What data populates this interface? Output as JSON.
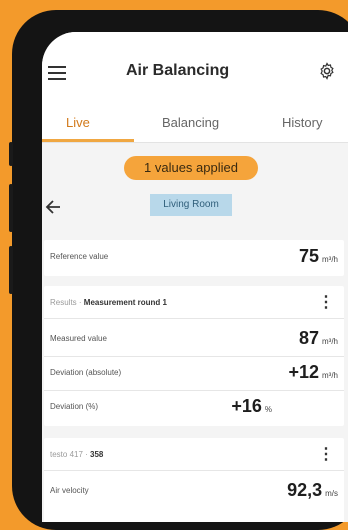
{
  "header": {
    "title": "Air Balancing"
  },
  "tabs": [
    {
      "label": "Live",
      "active": true
    },
    {
      "label": "Balancing",
      "active": false
    },
    {
      "label": "History",
      "active": false
    }
  ],
  "status_pill": "1 values applied",
  "room": "Living Room",
  "reference": {
    "label": "Reference value",
    "value": "75",
    "unit": "m³/h"
  },
  "round": {
    "prefix": "Results · ",
    "title": "Measurement round 1",
    "rows": [
      {
        "label": "Measured value",
        "value": "87",
        "unit": "m³/h"
      },
      {
        "label": "Deviation (absolute)",
        "value": "+12",
        "unit": "m³/h"
      },
      {
        "label": "Deviation (%)",
        "value": "+16",
        "unit": "%"
      }
    ]
  },
  "probe": {
    "name": "testo 417 · ",
    "id": "358",
    "rows": [
      {
        "label": "Air velocity",
        "value": "92,3",
        "unit": "m/s"
      }
    ]
  },
  "colors": {
    "accent": "#f5a43b",
    "room_chip": "#b8d8ea",
    "background": "#f39a2b"
  }
}
